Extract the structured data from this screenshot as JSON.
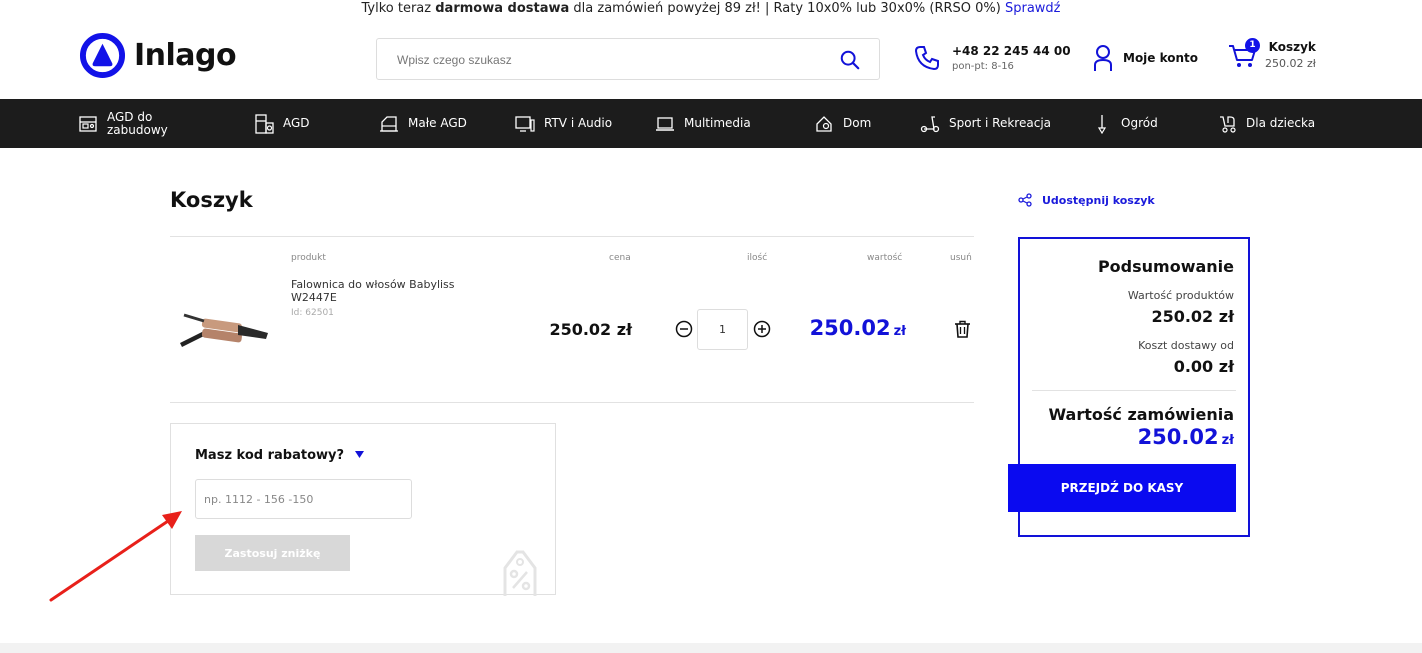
{
  "topbar": {
    "prefix": "Tylko teraz",
    "bold": "darmowa dostawa",
    "suffix": "dla zamówień powyżej 89 zł! | Raty 10x0% lub 30x0% (RRSO 0%)",
    "link": "Sprawdź"
  },
  "header": {
    "logo_text": "Inlago",
    "search_placeholder": "Wpisz czego szukasz",
    "phone_number": "+48 22 245 44 00",
    "phone_hours": "pon-pt: 8-16",
    "account_label": "Moje konto",
    "cart_label": "Koszyk",
    "cart_total": "250.02 zł",
    "cart_count": "1"
  },
  "nav": {
    "items": [
      {
        "label": "AGD do zabudowy",
        "icon": "built-in-appliance-icon"
      },
      {
        "label": "AGD",
        "icon": "fridge-icon"
      },
      {
        "label": "Małe AGD",
        "icon": "small-appliance-icon"
      },
      {
        "label": "RTV i Audio",
        "icon": "tv-icon"
      },
      {
        "label": "Multimedia",
        "icon": "laptop-icon"
      },
      {
        "label": "Dom",
        "icon": "house-icon"
      },
      {
        "label": "Sport i Rekreacja",
        "icon": "scooter-icon"
      },
      {
        "label": "Ogród",
        "icon": "garden-tool-icon"
      },
      {
        "label": "Dla dziecka",
        "icon": "stroller-icon"
      }
    ]
  },
  "cart": {
    "title": "Koszyk",
    "share_label": "Udostępnij koszyk",
    "columns": {
      "product": "produkt",
      "price": "cena",
      "qty": "ilość",
      "value": "wartość",
      "remove": "usuń"
    },
    "item": {
      "name": "Falownica do włosów Babyliss W2447E",
      "id": "Id: 62501",
      "price": "250.02 zł",
      "qty": "1",
      "value": "250.02",
      "currency": "zł"
    }
  },
  "coupon": {
    "title": "Masz kod rabatowy?",
    "placeholder": "np. 1112 - 156 -150",
    "apply_label": "Zastosuj zniżkę"
  },
  "summary": {
    "title": "Podsumowanie",
    "products_label": "Wartość produktów",
    "products_value": "250.02 zł",
    "shipping_label": "Koszt dostawy od",
    "shipping_value": "0.00 zł",
    "total_label": "Wartość zamówienia",
    "total_value": "250.02",
    "total_currency": "zł",
    "checkout_label": "PRZEJDŹ DO KASY"
  },
  "colors": {
    "accent": "#1212d8",
    "nav_bg": "#1c1c1c",
    "annotation_arrow": "#e8201a"
  }
}
